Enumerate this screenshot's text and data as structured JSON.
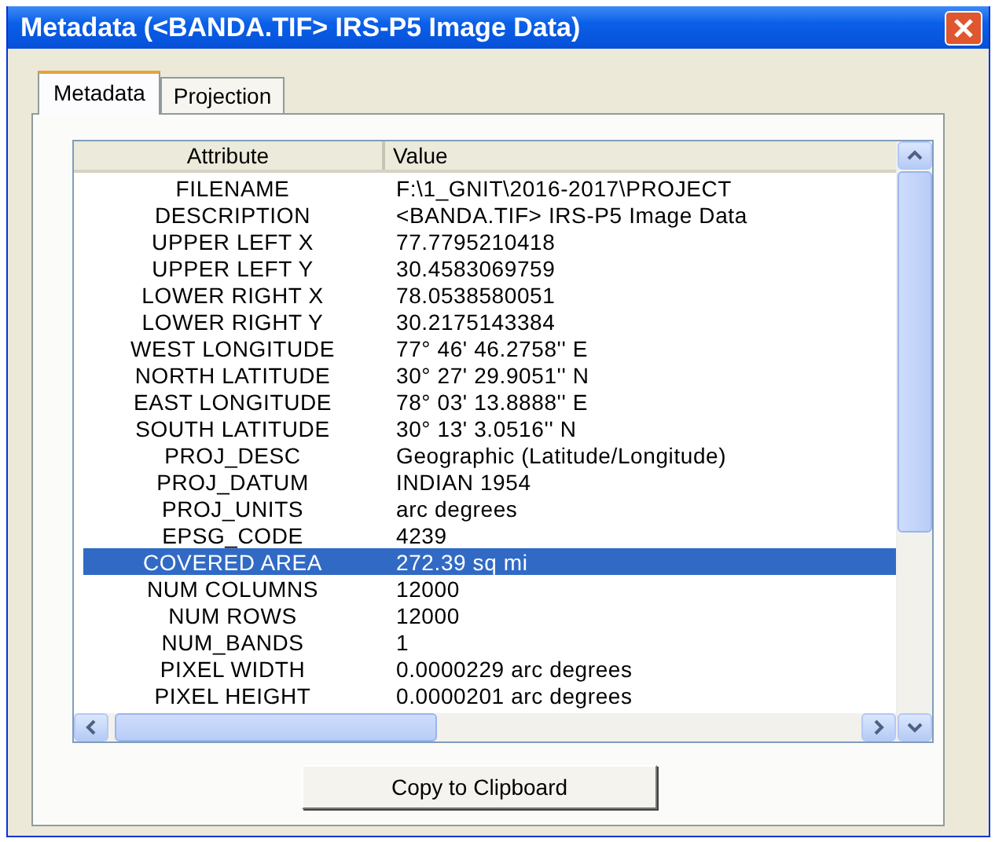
{
  "window": {
    "title": "Metadata (<BANDA.TIF> IRS-P5 Image Data)"
  },
  "tabs": [
    {
      "label": "Metadata",
      "selected": true
    },
    {
      "label": "Projection",
      "selected": false
    }
  ],
  "table": {
    "columns": [
      "Attribute",
      "Value"
    ],
    "rows": [
      {
        "attribute": "FILENAME",
        "value": "F:\\1_GNIT\\2016-2017\\PROJECT",
        "selected": false
      },
      {
        "attribute": "DESCRIPTION",
        "value": "<BANDA.TIF> IRS-P5 Image Data",
        "selected": false
      },
      {
        "attribute": "UPPER LEFT X",
        "value": "77.7795210418",
        "selected": false
      },
      {
        "attribute": "UPPER LEFT Y",
        "value": "30.4583069759",
        "selected": false
      },
      {
        "attribute": "LOWER RIGHT X",
        "value": "78.0538580051",
        "selected": false
      },
      {
        "attribute": "LOWER RIGHT Y",
        "value": "30.2175143384",
        "selected": false
      },
      {
        "attribute": "WEST LONGITUDE",
        "value": "77° 46' 46.2758'' E",
        "selected": false
      },
      {
        "attribute": "NORTH LATITUDE",
        "value": "30° 27' 29.9051'' N",
        "selected": false
      },
      {
        "attribute": "EAST LONGITUDE",
        "value": "78° 03' 13.8888'' E",
        "selected": false
      },
      {
        "attribute": "SOUTH LATITUDE",
        "value": "30° 13' 3.0516'' N",
        "selected": false
      },
      {
        "attribute": "PROJ_DESC",
        "value": "Geographic (Latitude/Longitude)",
        "selected": false
      },
      {
        "attribute": "PROJ_DATUM",
        "value": "INDIAN 1954",
        "selected": false
      },
      {
        "attribute": "PROJ_UNITS",
        "value": "arc degrees",
        "selected": false
      },
      {
        "attribute": "EPSG_CODE",
        "value": "4239",
        "selected": false
      },
      {
        "attribute": "COVERED AREA",
        "value": "272.39 sq mi",
        "selected": true
      },
      {
        "attribute": "NUM COLUMNS",
        "value": "12000",
        "selected": false
      },
      {
        "attribute": "NUM ROWS",
        "value": "12000",
        "selected": false
      },
      {
        "attribute": "NUM_BANDS",
        "value": "1",
        "selected": false
      },
      {
        "attribute": "PIXEL WIDTH",
        "value": "0.0000229 arc degrees",
        "selected": false
      },
      {
        "attribute": "PIXEL HEIGHT",
        "value": "0.0000201 arc degrees",
        "selected": false
      }
    ]
  },
  "buttons": [
    "Copy to Clipboard"
  ]
}
